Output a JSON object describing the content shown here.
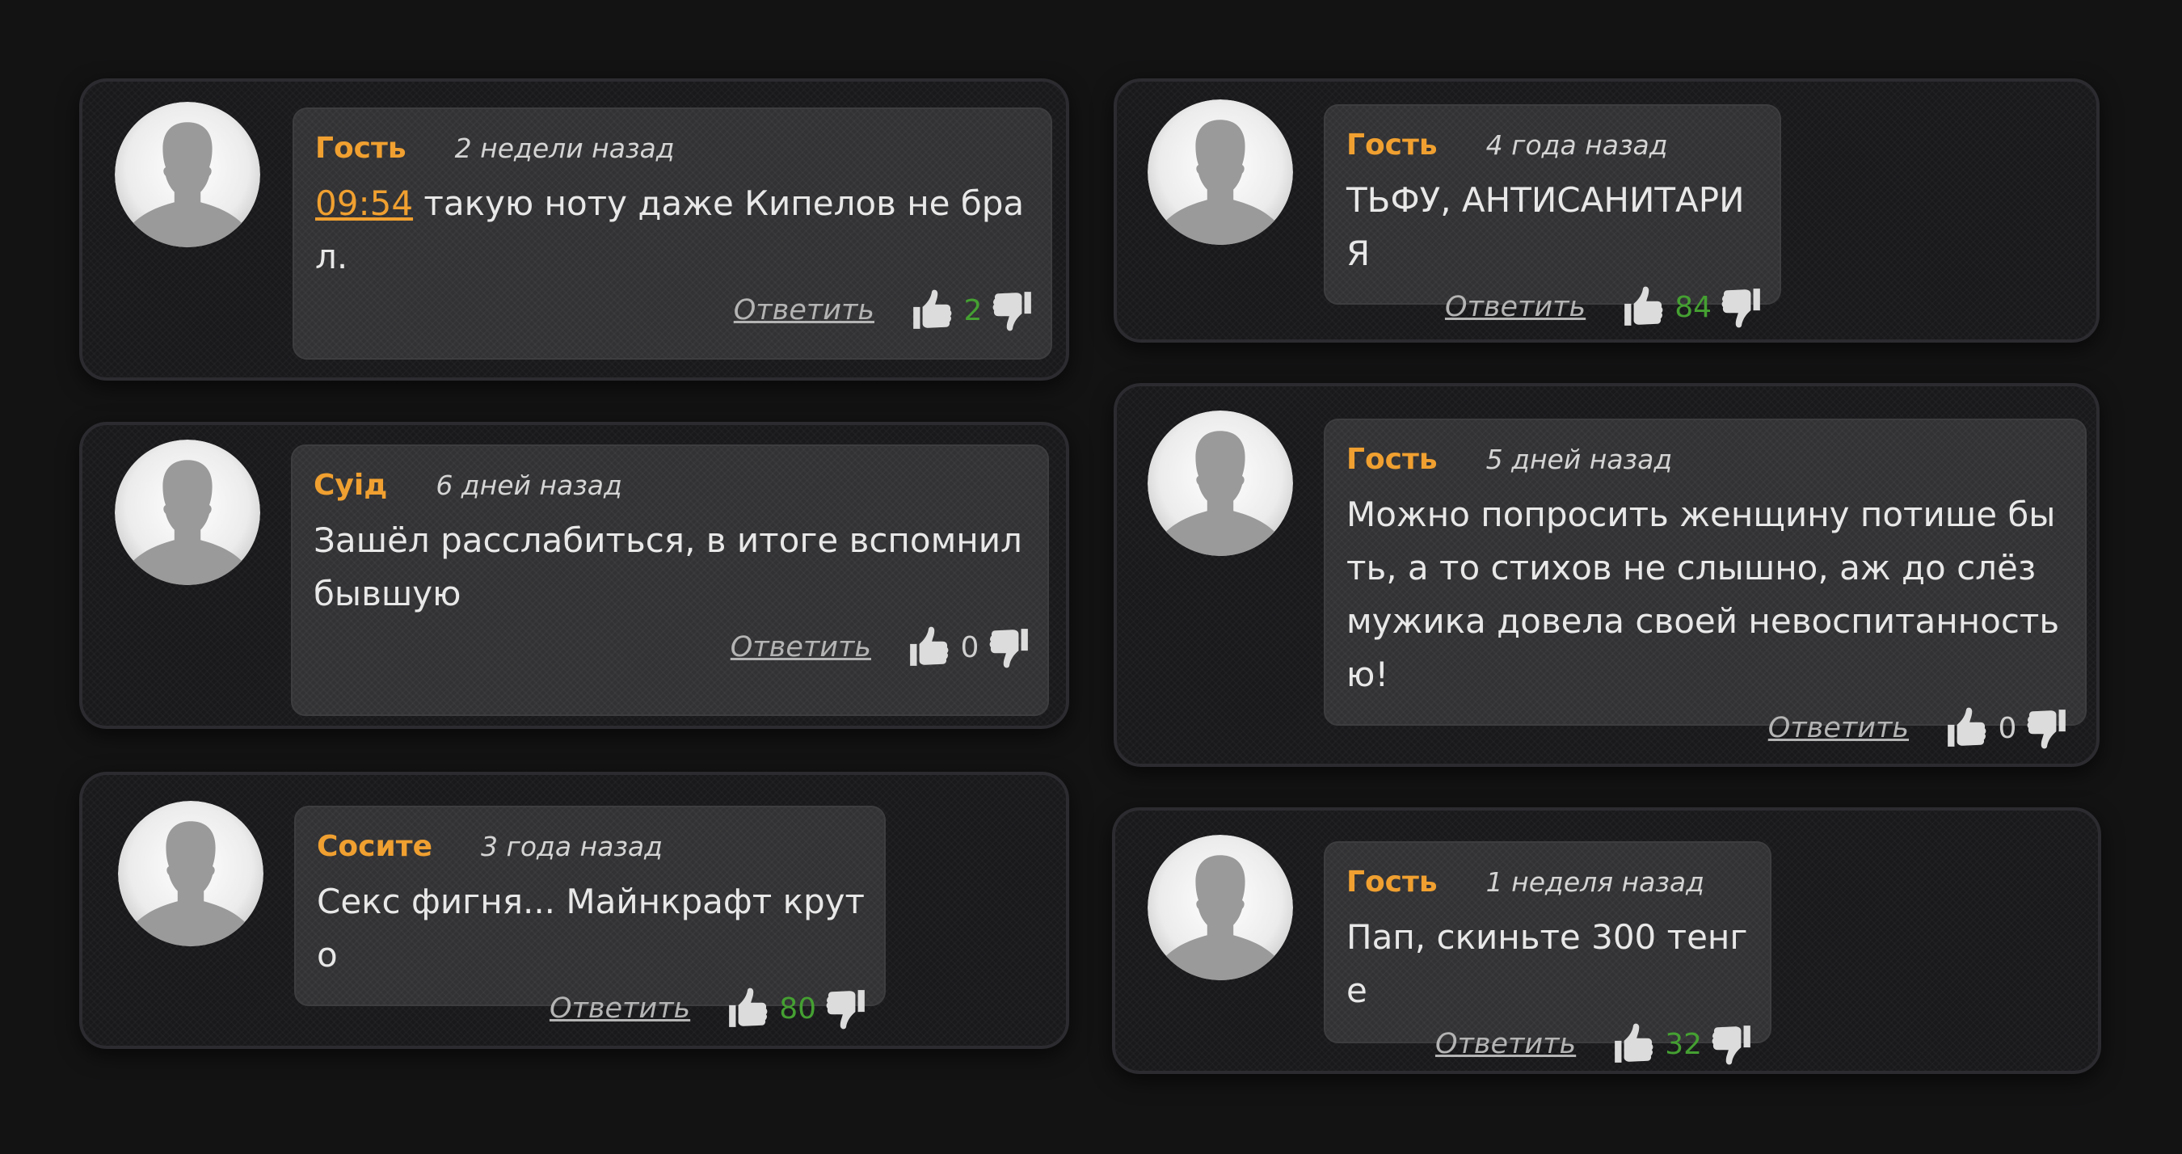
{
  "reply_label": "Ответить",
  "colors": {
    "author": "#f0a030",
    "positive_count": "#45a032",
    "background": "#131314"
  },
  "icons": {
    "avatar": "user-silhouette-icon",
    "like": "thumbs-up-icon",
    "dislike": "thumbs-down-icon"
  },
  "comments": [
    {
      "author": "Гость",
      "time": "2 недели назад",
      "timestamp": "09:54",
      "text": " такую ноту даже Кипелов не брал.",
      "likes": "2"
    },
    {
      "author": "Суід",
      "time": "6 дней назад",
      "text": "Зашёл расслабиться, в итоге вспомнил бывшую",
      "likes": "0"
    },
    {
      "author": "Сосите",
      "time": "3 года назад",
      "text": "Секс фигня... Майнкрафт круто",
      "likes": "80"
    },
    {
      "author": "Гость",
      "time": "4 года назад",
      "text": "ТЬФУ, АНТИСАНИТАРИЯ",
      "likes": "84"
    },
    {
      "author": "Гость",
      "time": "5 дней назад",
      "text": "Можно попросить женщину потише быть, а то стихов не слышно, аж до слёз мужика довела своей невоспитанностью!",
      "likes": "0"
    },
    {
      "author": "Гость",
      "time": "1 неделя назад",
      "text": "Пап, скиньте 300 тенге",
      "likes": "32"
    }
  ]
}
